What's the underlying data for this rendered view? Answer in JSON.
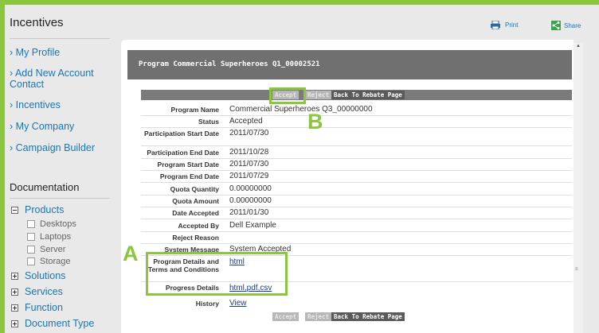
{
  "sidebar": {
    "title": "Incentives",
    "nav": [
      {
        "label": "My Profile"
      },
      {
        "label": "Add New Account Contact"
      },
      {
        "label": "Incentives"
      },
      {
        "label": "My Company"
      },
      {
        "label": "Campaign Builder"
      }
    ],
    "documentation_title": "Documentation",
    "tree": {
      "products": "Products",
      "sub": [
        "Desktops",
        "Laptops",
        "Server",
        "Storage"
      ],
      "solutions": "Solutions",
      "services": "Services",
      "function": "Function",
      "document_type": "Document Type"
    },
    "arrow": "›"
  },
  "toolbar": {
    "print_label": "Print",
    "share_label": "Share",
    "print_icon": "printer-icon",
    "share_icon": "share-icon"
  },
  "program": {
    "header_title": "Program Commercial Superheroes Q1_00002521",
    "buttons": {
      "accept": "Accept",
      "reject": "Reject",
      "back": "Back To Rebate Page"
    },
    "rows": [
      {
        "label": "Program Name",
        "value": "Commercial Superheroes Q3_00000000"
      },
      {
        "label": "Status",
        "value": "Accepted"
      },
      {
        "label": "Participation Start Date",
        "value": "2011/07/30"
      },
      {
        "label": "Participation End Date",
        "value": "2011/10/28"
      },
      {
        "label": "Program Start Date",
        "value": "2011/07/30"
      },
      {
        "label": "Program End Date",
        "value": "2011/07/29"
      },
      {
        "label": "Quota Quantity",
        "value": "0.00000000"
      },
      {
        "label": "Quota Amount",
        "value": "0.00000000"
      },
      {
        "label": "Date Accepted",
        "value": "2011/01/30"
      },
      {
        "label": "Accepted By",
        "value": "Dell Example"
      },
      {
        "label": "Reject Reason",
        "value": ""
      },
      {
        "label": "System Message",
        "value": "System Accepted"
      },
      {
        "label": "Program Details and Terms and Conditions",
        "value": "html"
      },
      {
        "label": "Progress Details",
        "value": "html,pdf,csv"
      },
      {
        "label": "History",
        "value": "View"
      }
    ]
  },
  "callouts": {
    "a": "A",
    "b": "B"
  },
  "colors": {
    "accent": "#8cc63e",
    "link": "#1a76b3",
    "header": "#707070"
  }
}
